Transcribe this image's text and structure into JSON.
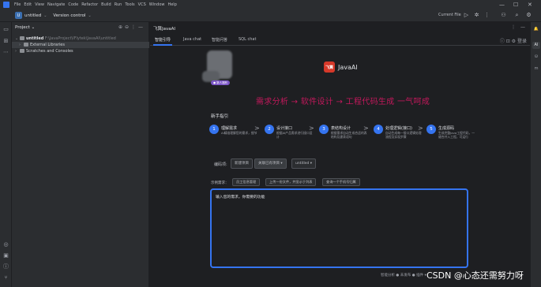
{
  "menubar": {
    "items": [
      "File",
      "Edit",
      "View",
      "Navigate",
      "Code",
      "Refactor",
      "Build",
      "Run",
      "Tools",
      "VCS",
      "Window",
      "Help"
    ],
    "window_controls": [
      "—",
      "☐",
      "✕"
    ]
  },
  "titlebar": {
    "project_badge": "U",
    "project_name": "untitled",
    "vcs": "Version control",
    "current_file": "Current File"
  },
  "project_panel": {
    "title": "Project",
    "rows": [
      {
        "arrow": "⌄",
        "name": "untitled",
        "path": "F:\\JavaProject\\IFlytek\\JavaAI\\untitled"
      },
      {
        "arrow": "›",
        "name": "External Libraries",
        "path": ""
      },
      {
        "arrow": "›",
        "name": "Scratches and Consoles",
        "path": ""
      }
    ]
  },
  "plugin": {
    "title": "飞算JavaAI",
    "tabs": [
      "智能引导",
      "Java chat",
      "智能问答",
      "SQL chat"
    ],
    "settings_label": "登录",
    "avatar_badge": "● 新人福利",
    "brand_logo": "飞算",
    "brand_name": "JavaAI",
    "slogan": "需求分析 → 软件设计 → 工程代码生成 一气呵成",
    "guide_title": "新手指引",
    "steps": [
      {
        "num": "1",
        "title": "理解需求",
        "desc": "AI精准理解您的需求，细节"
      },
      {
        "num": "2",
        "title": "设计接口",
        "desc": "根据AI产品需求进行接口设计"
      },
      {
        "num": "3",
        "title": "表结构设计",
        "desc": "根据需求自动生成合适的表结构及建表语句"
      },
      {
        "num": "4",
        "title": "处理逻辑(接口)",
        "desc": "自动生成每一接口逻辑处理流程及实现步骤"
      },
      {
        "num": "5",
        "title": "生成源码",
        "desc": "生成完整Java工程代码，一键合并入工程，可运行"
      }
    ],
    "code_label": "编码项:",
    "segments": [
      "新建项目",
      "关联已有项目 ▾",
      "untitled ▾"
    ],
    "gen_label": "示例需求：",
    "chips": [
      "员工信息管理",
      "上传一份文件，并显示于列表",
      "查询一个手机号归属"
    ],
    "input_placeholder": "输入您的需求，你需要的功能",
    "footer": "智能分析 ● 未发布 ● 插件 ▾"
  },
  "watermark": "CSDN @心态还需努力呀"
}
